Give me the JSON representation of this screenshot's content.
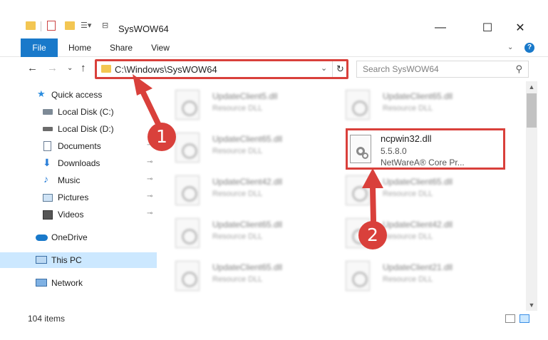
{
  "window": {
    "title": "SysWOW64",
    "minimize_glyph": "—",
    "maximize_glyph": "☐",
    "close_glyph": "✕"
  },
  "ribbon": {
    "tabs": [
      "File",
      "Home",
      "Share",
      "View"
    ],
    "collapse_glyph": "⌄",
    "help_glyph": "?"
  },
  "nav": {
    "back_glyph": "←",
    "forward_glyph": "→",
    "recent_glyph": "⌄",
    "up_glyph": "↑",
    "address": "C:\\Windows\\SysWOW64",
    "address_dropdown_glyph": "⌄",
    "refresh_glyph": "↻",
    "search_placeholder": "Search SysWOW64",
    "search_glyph": "⚲"
  },
  "sidebar": {
    "items": [
      {
        "label": "Quick access",
        "icon": "star-icon",
        "pinned": false
      },
      {
        "label": "Local Disk (C:)",
        "icon": "drive-icon",
        "pinned": true
      },
      {
        "label": "Local Disk (D:)",
        "icon": "drive-icon",
        "pinned": true
      },
      {
        "label": "Documents",
        "icon": "documents-icon",
        "pinned": true
      },
      {
        "label": "Downloads",
        "icon": "download-icon",
        "pinned": true
      },
      {
        "label": "Music",
        "icon": "music-icon",
        "pinned": true
      },
      {
        "label": "Pictures",
        "icon": "pictures-icon",
        "pinned": true
      },
      {
        "label": "Videos",
        "icon": "videos-icon",
        "pinned": true
      },
      {
        "label": "OneDrive",
        "icon": "cloud-icon",
        "pinned": false
      },
      {
        "label": "This PC",
        "icon": "computer-icon",
        "pinned": false,
        "selected": true
      },
      {
        "label": "Network",
        "icon": "network-icon",
        "pinned": false
      }
    ],
    "pin_glyph": "📌"
  },
  "files": [
    {
      "name": "UpdateClient5.dll",
      "type": "Resource DLL"
    },
    {
      "name": "UpdateClient65.dll",
      "type": "Resource DLL"
    },
    {
      "name": "UpdateClient65.dll",
      "type": "Resource DLL"
    },
    {
      "name": "UpdateClient42.dll",
      "type": "Resource DLL"
    },
    {
      "name": "UpdateClient65.dll",
      "type": "Resource DLL"
    },
    {
      "name": "UpdateClient65.dll",
      "type": "Resource DLL"
    },
    {
      "name": "UpdateClient42.dll",
      "type": "Resource DLL"
    },
    {
      "name": "UpdateClient65.dll",
      "type": "Resource DLL"
    },
    {
      "name": "UpdateClient21.dll",
      "type": "Resource DLL"
    }
  ],
  "highlighted_file": {
    "name": "ncpwin32.dll",
    "version": "5.5.8.0",
    "description": "NetWareA® Core Pr..."
  },
  "annotations": {
    "step1": "1",
    "step2": "2",
    "color": "#d9403b"
  },
  "scrollbar": {
    "up_glyph": "▲",
    "down_glyph": "▼"
  },
  "status": {
    "item_count": "104 items"
  }
}
